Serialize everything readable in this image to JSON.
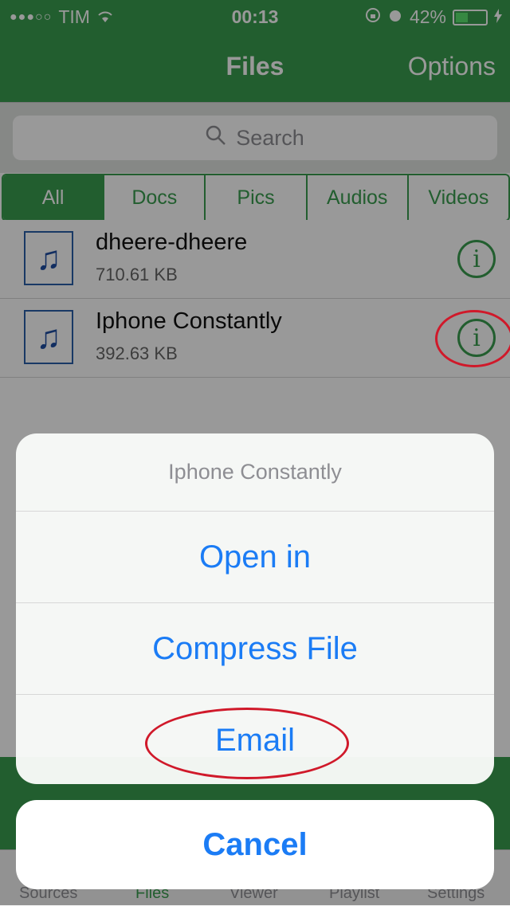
{
  "status_bar": {
    "signal": "●●●○○",
    "carrier": "TIM",
    "time": "00:13",
    "battery_percent": "42%",
    "battery_level": 0.42
  },
  "navbar": {
    "title": "Files",
    "options_label": "Options"
  },
  "search": {
    "placeholder": "Search"
  },
  "segments": [
    {
      "label": "All",
      "active": true
    },
    {
      "label": "Docs",
      "active": false
    },
    {
      "label": "Pics",
      "active": false
    },
    {
      "label": "Audios",
      "active": false
    },
    {
      "label": "Videos",
      "active": false
    }
  ],
  "files": [
    {
      "name": "dheere-dheere",
      "size": "710.61  KB",
      "icon": "music-note-icon"
    },
    {
      "name": "Iphone Constantly",
      "size": "392.63  KB",
      "icon": "music-note-icon"
    }
  ],
  "info_icon_glyph": "i",
  "tabs": [
    {
      "label": "Sources"
    },
    {
      "label": "Files",
      "active": true
    },
    {
      "label": "Viewer"
    },
    {
      "label": "Playlist"
    },
    {
      "label": "Settings"
    }
  ],
  "action_sheet": {
    "title": "Iphone Constantly",
    "buttons": [
      "Open in",
      "Compress File",
      "Email"
    ],
    "cancel_label": "Cancel"
  },
  "colors": {
    "accent_green": "#3a9d4f",
    "action_blue": "#1b7cf5",
    "annotation_red": "#d0192a"
  }
}
